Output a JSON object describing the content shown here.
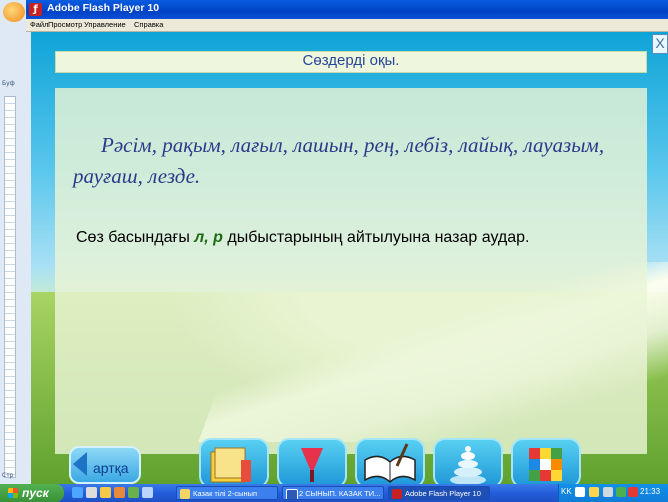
{
  "window": {
    "title": "Adobe Flash Player 10"
  },
  "menu": [
    "Файл",
    "Просмотр",
    "Управление",
    "Справка"
  ],
  "slide": {
    "title": "Сөздерді оқы.",
    "words": "Рәсім, рақым, лағыл, лашын, рең, лебіз, лайық, лауазым, рауғаш, лезде.",
    "instruction_before": "Сөз басындағы ",
    "instruction_letters": "л, р",
    "instruction_after": " дыбыстарының айтылуына назар аудар.",
    "close_label": "X",
    "back_label": "артқа"
  },
  "bottom_buttons": [
    {
      "name": "book-icon"
    },
    {
      "name": "pen-icon"
    },
    {
      "name": "open-book-icon"
    },
    {
      "name": "pyramid-icon"
    },
    {
      "name": "rubiks-cube-icon"
    }
  ],
  "taskbar": {
    "start_label": "пуск",
    "items": [
      {
        "label": "Казак тілі 2-сынып",
        "active": false
      },
      {
        "label": "2 СЫНЫП. КАЗАК ТИ...",
        "active": false
      },
      {
        "label": "Adobe Flash Player 10",
        "active": true
      }
    ],
    "language": "KK",
    "clock": "21:33"
  },
  "background_window": {
    "labels": [
      "Буф",
      "Стр"
    ]
  }
}
